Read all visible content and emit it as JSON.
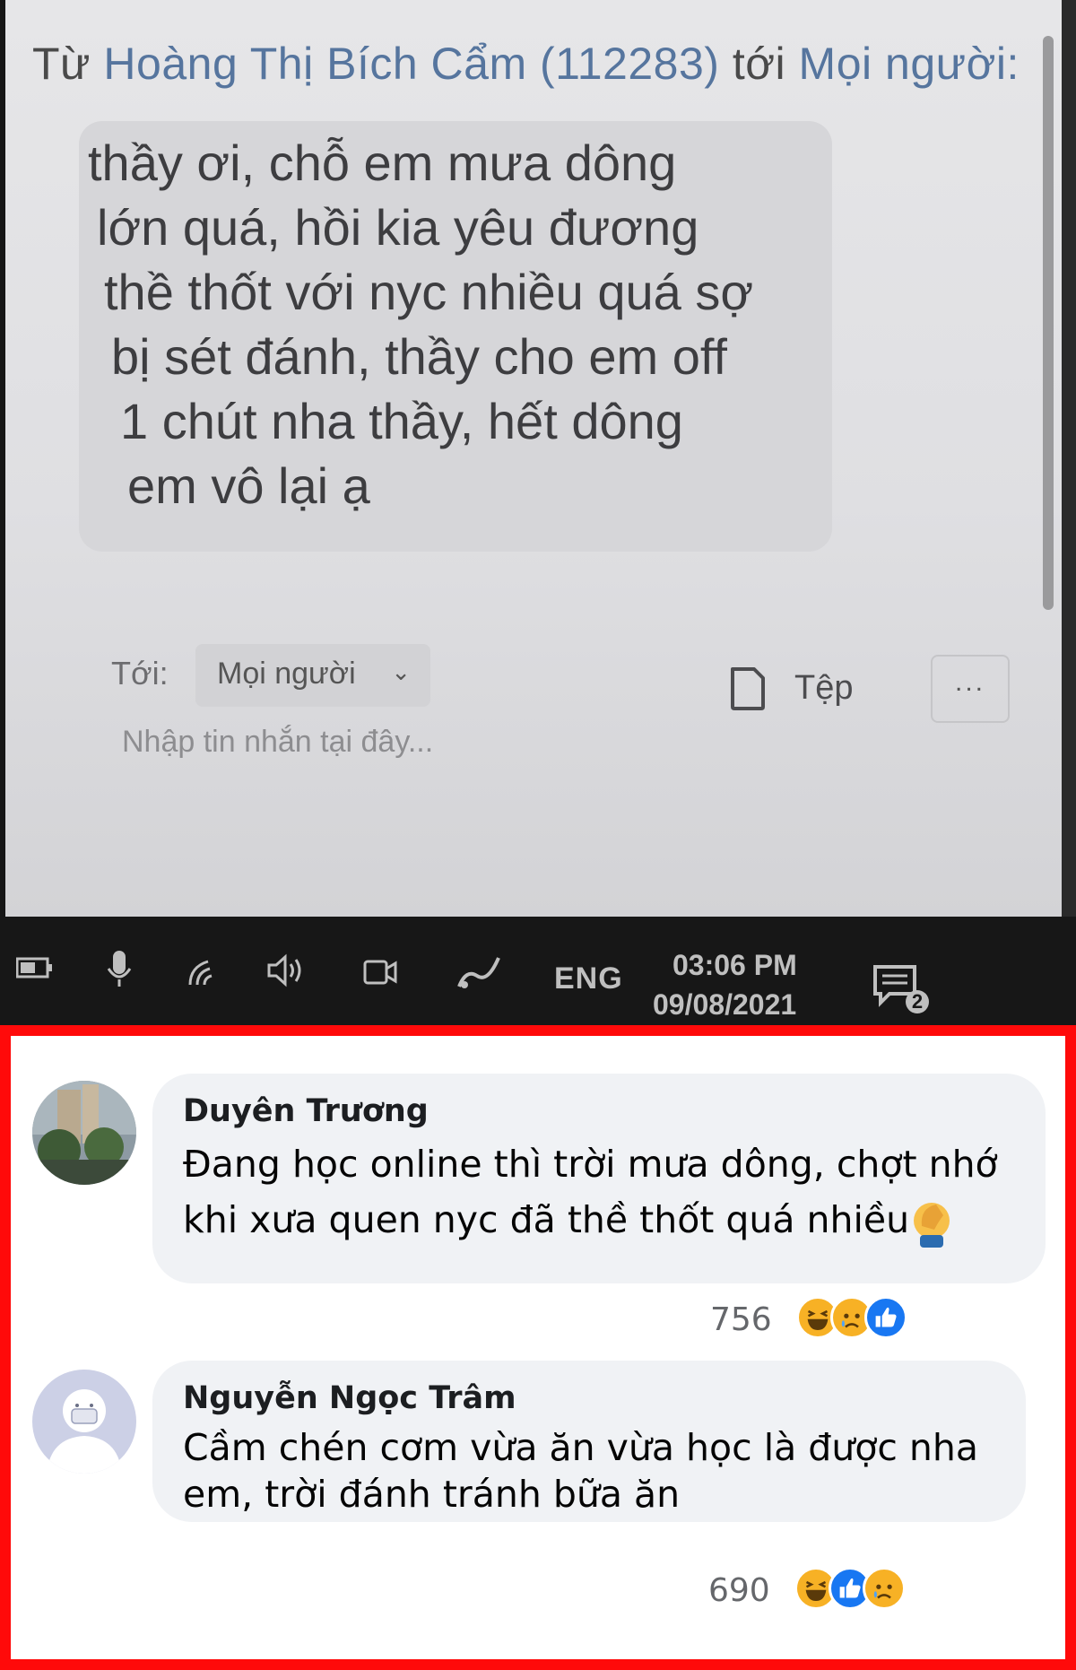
{
  "chat": {
    "from_prefix": "Từ",
    "sender": "Hoàng Thị Bích Cẩm (112283)",
    "to_word": "tới",
    "recipient": "Mọi người:",
    "message_lines": [
      "thầy ơi, chỗ em mưa dông",
      "lớn quá, hồi kia yêu đương",
      "thề thốt với nyc nhiều quá sợ",
      "bị sét đánh, thầy cho em off",
      "1 chút nha thầy, hết dông",
      "em vô lại ạ"
    ],
    "to_label": "Tới:",
    "to_value": "Mọi người",
    "file_label": "Tệp",
    "more_label": "...",
    "input_placeholder": "Nhập tin nhắn tại đây..."
  },
  "taskbar": {
    "language": "ENG",
    "time": "03:06 PM",
    "date": "09/08/2021",
    "notification_count": "2"
  },
  "comments": [
    {
      "name": "Duyên Trương",
      "text_lines": [
        "Đang học online thì trời mưa dông, chợt nhớ",
        "khi xưa quen nyc đã thề thốt quá nhiều"
      ],
      "reaction_count": "756",
      "reactions": [
        "haha",
        "sad",
        "like"
      ],
      "emoji": "facepalm"
    },
    {
      "name": "Nguyễn Ngọc Trâm",
      "text_lines": [
        "Cầm chén cơm vừa ăn vừa học là được nha",
        "em, trời đánh tránh bữa ăn"
      ],
      "reaction_count": "690",
      "reactions": [
        "haha",
        "like",
        "sad"
      ]
    }
  ],
  "colors": {
    "frame_red": "#ff0a0a",
    "link_blue": "#56759e",
    "bubble_gray": "#f0f2f5",
    "like_blue": "#1877f2",
    "haha_yellow": "#f7b125"
  }
}
